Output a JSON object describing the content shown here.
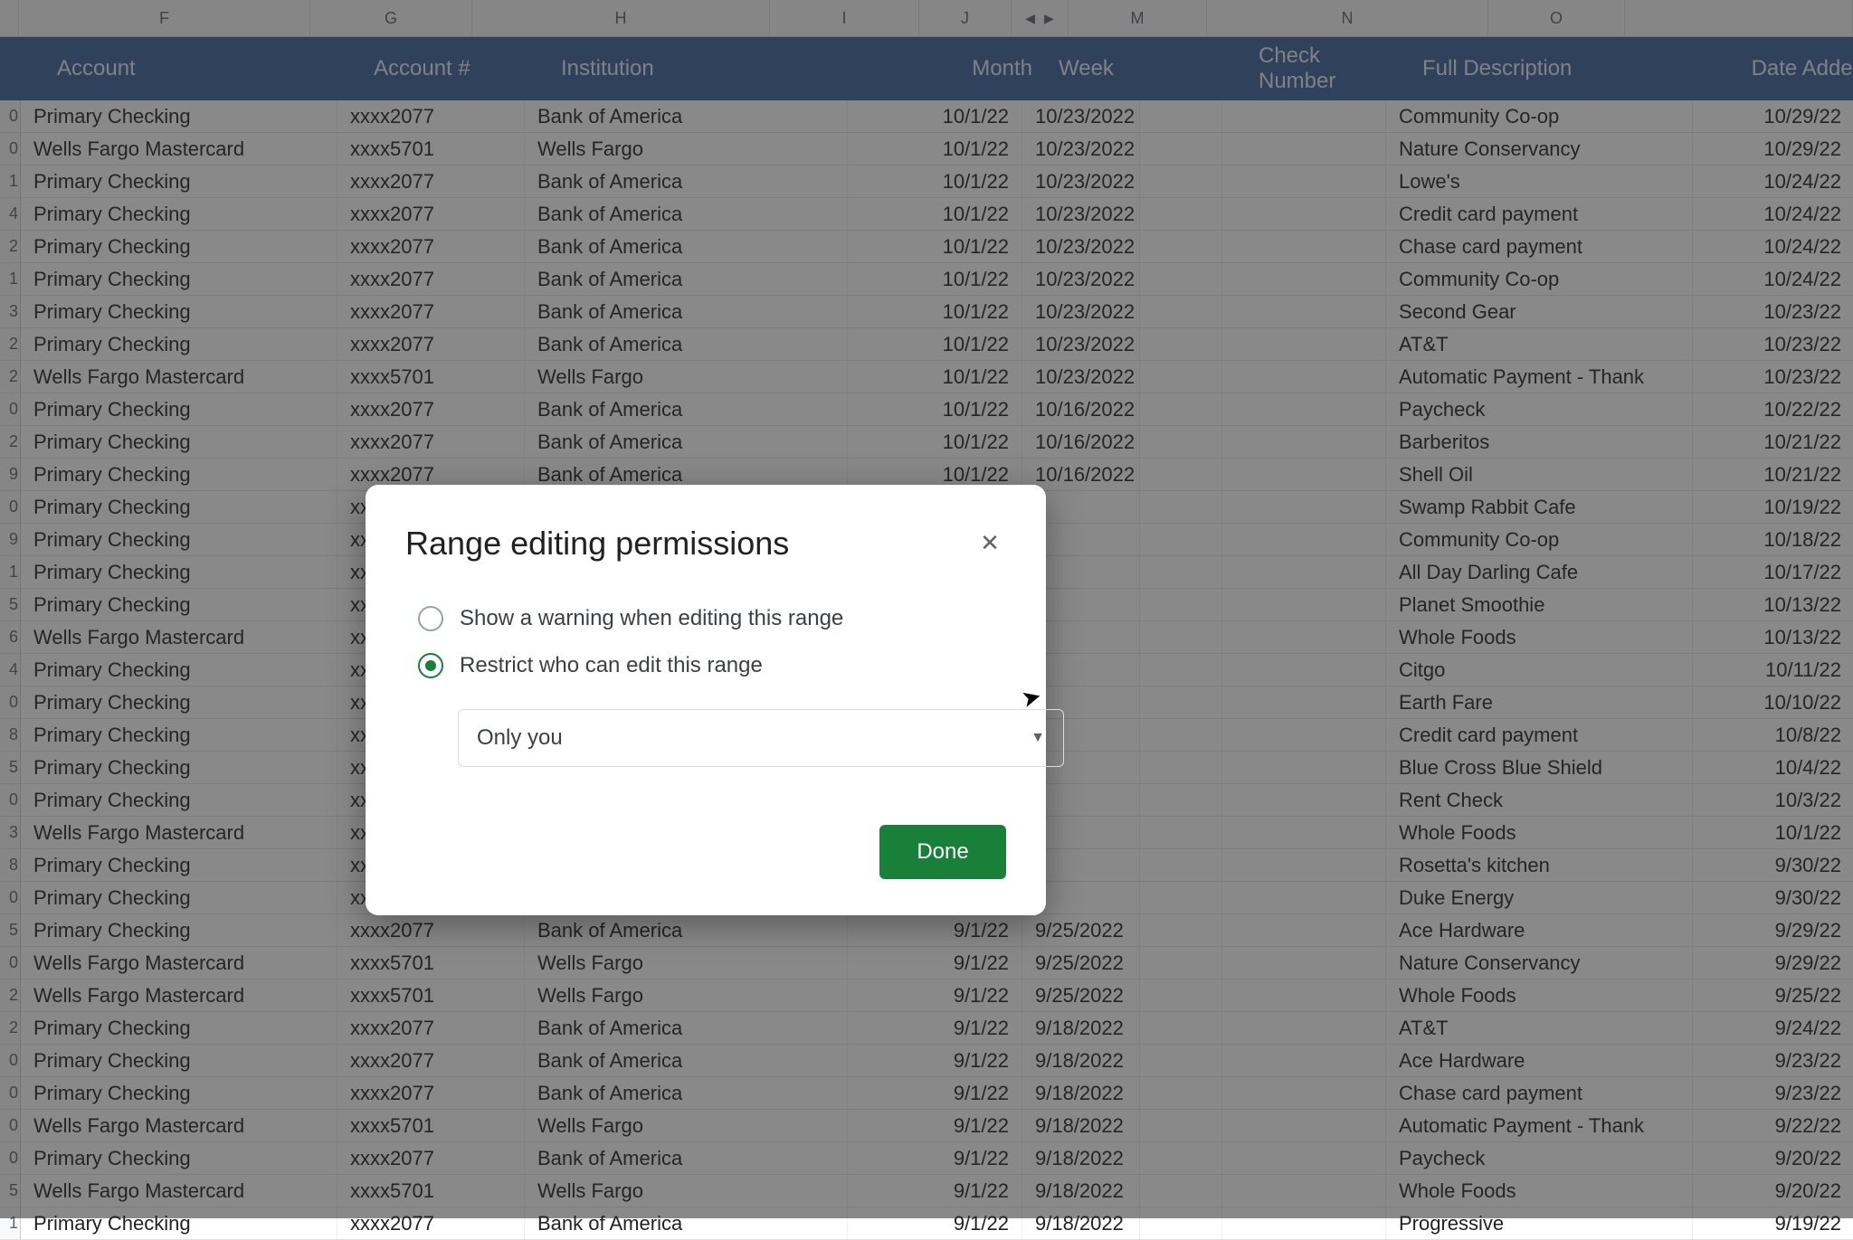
{
  "columns": [
    "F",
    "G",
    "H",
    "I",
    "J",
    "M",
    "N",
    "O"
  ],
  "headers": {
    "account": "Account",
    "account_num": "Account #",
    "institution": "Institution",
    "month": "Month",
    "week": "Week",
    "check_number": "Check Number",
    "full_description": "Full Description",
    "date_added": "Date Added"
  },
  "rows": [
    {
      "rn": "0",
      "account": "Primary Checking",
      "acct": "xxxx2077",
      "inst": "Bank of America",
      "month": "10/1/22",
      "week": "10/23/2022",
      "check": "",
      "desc": "Community Co-op",
      "added": "10/29/22"
    },
    {
      "rn": "0",
      "account": "Wells Fargo Mastercard",
      "acct": "xxxx5701",
      "inst": "Wells Fargo",
      "month": "10/1/22",
      "week": "10/23/2022",
      "check": "",
      "desc": "Nature Conservancy",
      "added": "10/29/22"
    },
    {
      "rn": "1",
      "account": "Primary Checking",
      "acct": "xxxx2077",
      "inst": "Bank of America",
      "month": "10/1/22",
      "week": "10/23/2022",
      "check": "",
      "desc": "Lowe's",
      "added": "10/24/22"
    },
    {
      "rn": "4",
      "account": "Primary Checking",
      "acct": "xxxx2077",
      "inst": "Bank of America",
      "month": "10/1/22",
      "week": "10/23/2022",
      "check": "",
      "desc": "Credit card payment",
      "added": "10/24/22"
    },
    {
      "rn": "2",
      "account": "Primary Checking",
      "acct": "xxxx2077",
      "inst": "Bank of America",
      "month": "10/1/22",
      "week": "10/23/2022",
      "check": "",
      "desc": "Chase card payment",
      "added": "10/24/22"
    },
    {
      "rn": "1",
      "account": "Primary Checking",
      "acct": "xxxx2077",
      "inst": "Bank of America",
      "month": "10/1/22",
      "week": "10/23/2022",
      "check": "",
      "desc": "Community Co-op",
      "added": "10/24/22"
    },
    {
      "rn": "3",
      "account": "Primary Checking",
      "acct": "xxxx2077",
      "inst": "Bank of America",
      "month": "10/1/22",
      "week": "10/23/2022",
      "check": "",
      "desc": "Second Gear",
      "added": "10/23/22"
    },
    {
      "rn": "2",
      "account": "Primary Checking",
      "acct": "xxxx2077",
      "inst": "Bank of America",
      "month": "10/1/22",
      "week": "10/23/2022",
      "check": "",
      "desc": "AT&T",
      "added": "10/23/22"
    },
    {
      "rn": "2",
      "account": "Wells Fargo Mastercard",
      "acct": "xxxx5701",
      "inst": "Wells Fargo",
      "month": "10/1/22",
      "week": "10/23/2022",
      "check": "",
      "desc": "Automatic Payment - Thank",
      "added": "10/23/22"
    },
    {
      "rn": "0",
      "account": "Primary Checking",
      "acct": "xxxx2077",
      "inst": "Bank of America",
      "month": "10/1/22",
      "week": "10/16/2022",
      "check": "",
      "desc": "Paycheck",
      "added": "10/22/22"
    },
    {
      "rn": "2",
      "account": "Primary Checking",
      "acct": "xxxx2077",
      "inst": "Bank of America",
      "month": "10/1/22",
      "week": "10/16/2022",
      "check": "",
      "desc": "Barberitos",
      "added": "10/21/22"
    },
    {
      "rn": "9",
      "account": "Primary Checking",
      "acct": "xxxx2077",
      "inst": "Bank of America",
      "month": "10/1/22",
      "week": "10/16/2022",
      "check": "",
      "desc": "Shell Oil",
      "added": "10/21/22"
    },
    {
      "rn": "0",
      "account": "Primary Checking",
      "acct": "xxxx",
      "inst": "",
      "month": "",
      "week": "",
      "check": "",
      "desc": "Swamp Rabbit Cafe",
      "added": "10/19/22"
    },
    {
      "rn": "9",
      "account": "Primary Checking",
      "acct": "xxxx",
      "inst": "",
      "month": "",
      "week": "",
      "check": "",
      "desc": "Community Co-op",
      "added": "10/18/22"
    },
    {
      "rn": "1",
      "account": "Primary Checking",
      "acct": "xxxx",
      "inst": "",
      "month": "",
      "week": "",
      "check": "",
      "desc": "All Day Darling Cafe",
      "added": "10/17/22"
    },
    {
      "rn": "5",
      "account": "Primary Checking",
      "acct": "xxxx",
      "inst": "",
      "month": "",
      "week": "",
      "check": "",
      "desc": "Planet Smoothie",
      "added": "10/13/22"
    },
    {
      "rn": "6",
      "account": "Wells Fargo Mastercard",
      "acct": "xxxx",
      "inst": "",
      "month": "",
      "week": "",
      "check": "",
      "desc": "Whole Foods",
      "added": "10/13/22"
    },
    {
      "rn": "4",
      "account": "Primary Checking",
      "acct": "xxxx",
      "inst": "",
      "month": "",
      "week": "",
      "check": "",
      "desc": "Citgo",
      "added": "10/11/22"
    },
    {
      "rn": "0",
      "account": "Primary Checking",
      "acct": "xxxx",
      "inst": "",
      "month": "",
      "week": "",
      "check": "",
      "desc": "Earth Fare",
      "added": "10/10/22"
    },
    {
      "rn": "8",
      "account": "Primary Checking",
      "acct": "xxxx",
      "inst": "",
      "month": "",
      "week": "",
      "check": "",
      "desc": "Credit card payment",
      "added": "10/8/22"
    },
    {
      "rn": "5",
      "account": "Primary Checking",
      "acct": "xxxx",
      "inst": "",
      "month": "",
      "week": "",
      "check": "",
      "desc": "Blue Cross Blue Shield",
      "added": "10/4/22"
    },
    {
      "rn": "0",
      "account": "Primary Checking",
      "acct": "xxxx",
      "inst": "",
      "month": "",
      "week": "",
      "check": "",
      "desc": "Rent Check",
      "added": "10/3/22"
    },
    {
      "rn": "3",
      "account": "Wells Fargo Mastercard",
      "acct": "xxxx",
      "inst": "",
      "month": "",
      "week": "",
      "check": "",
      "desc": "Whole Foods",
      "added": "10/1/22"
    },
    {
      "rn": "8",
      "account": "Primary Checking",
      "acct": "xxxx",
      "inst": "",
      "month": "",
      "week": "",
      "check": "",
      "desc": "Rosetta's kitchen",
      "added": "9/30/22"
    },
    {
      "rn": "0",
      "account": "Primary Checking",
      "acct": "xxxx",
      "inst": "",
      "month": "",
      "week": "",
      "check": "",
      "desc": "Duke Energy",
      "added": "9/30/22"
    },
    {
      "rn": "5",
      "account": "Primary Checking",
      "acct": "xxxx2077",
      "inst": "Bank of America",
      "month": "9/1/22",
      "week": "9/25/2022",
      "check": "",
      "desc": "Ace Hardware",
      "added": "9/29/22"
    },
    {
      "rn": "0",
      "account": "Wells Fargo Mastercard",
      "acct": "xxxx5701",
      "inst": "Wells Fargo",
      "month": "9/1/22",
      "week": "9/25/2022",
      "check": "",
      "desc": "Nature Conservancy",
      "added": "9/29/22"
    },
    {
      "rn": "2",
      "account": "Wells Fargo Mastercard",
      "acct": "xxxx5701",
      "inst": "Wells Fargo",
      "month": "9/1/22",
      "week": "9/25/2022",
      "check": "",
      "desc": "Whole Foods",
      "added": "9/25/22"
    },
    {
      "rn": "2",
      "account": "Primary Checking",
      "acct": "xxxx2077",
      "inst": "Bank of America",
      "month": "9/1/22",
      "week": "9/18/2022",
      "check": "",
      "desc": "AT&T",
      "added": "9/24/22"
    },
    {
      "rn": "0",
      "account": "Primary Checking",
      "acct": "xxxx2077",
      "inst": "Bank of America",
      "month": "9/1/22",
      "week": "9/18/2022",
      "check": "",
      "desc": "Ace Hardware",
      "added": "9/23/22"
    },
    {
      "rn": "0",
      "account": "Primary Checking",
      "acct": "xxxx2077",
      "inst": "Bank of America",
      "month": "9/1/22",
      "week": "9/18/2022",
      "check": "",
      "desc": "Chase card payment",
      "added": "9/23/22"
    },
    {
      "rn": "0",
      "account": "Wells Fargo Mastercard",
      "acct": "xxxx5701",
      "inst": "Wells Fargo",
      "month": "9/1/22",
      "week": "9/18/2022",
      "check": "",
      "desc": "Automatic Payment - Thank",
      "added": "9/22/22"
    },
    {
      "rn": "0",
      "account": "Primary Checking",
      "acct": "xxxx2077",
      "inst": "Bank of America",
      "month": "9/1/22",
      "week": "9/18/2022",
      "check": "",
      "desc": "Paycheck",
      "added": "9/20/22"
    },
    {
      "rn": "5",
      "account": "Wells Fargo Mastercard",
      "acct": "xxxx5701",
      "inst": "Wells Fargo",
      "month": "9/1/22",
      "week": "9/18/2022",
      "check": "",
      "desc": "Whole Foods",
      "added": "9/20/22"
    },
    {
      "rn": "1",
      "account": "Primary Checking",
      "acct": "xxxx2077",
      "inst": "Bank of America",
      "month": "9/1/22",
      "week": "9/18/2022",
      "check": "",
      "desc": "Progressive",
      "added": "9/19/22"
    }
  ],
  "dialog": {
    "title": "Range editing permissions",
    "option_warning": "Show a warning when editing this range",
    "option_restrict": "Restrict who can edit this range",
    "select_value": "Only you",
    "done": "Done"
  }
}
